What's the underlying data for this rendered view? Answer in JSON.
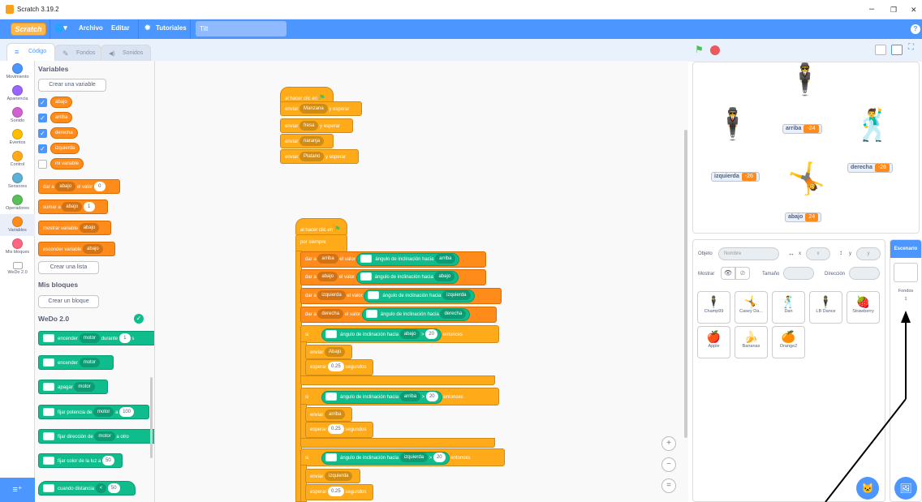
{
  "window": {
    "title": "Scratch 3.19.2",
    "min": "–",
    "max": "❐",
    "close": "✕"
  },
  "menubar": {
    "logo": "Scratch",
    "globe": "🌐▾",
    "archivo": "Archivo",
    "editar": "Editar",
    "tutoriales": "Tutoriales",
    "project_title": "Tilt",
    "help": "?"
  },
  "tabs": [
    {
      "label": "Código",
      "icon": "≡"
    },
    {
      "label": "Fondos",
      "icon": "✎"
    },
    {
      "label": "Sonidos",
      "icon": "◀)"
    }
  ],
  "categories": [
    {
      "label": "Movimiento",
      "color": "#4c97ff"
    },
    {
      "label": "Apariencia",
      "color": "#9966ff"
    },
    {
      "label": "Sonido",
      "color": "#cf63cf"
    },
    {
      "label": "Eventos",
      "color": "#ffbf00"
    },
    {
      "label": "Control",
      "color": "#ffab19"
    },
    {
      "label": "Sensores",
      "color": "#5cb1d6"
    },
    {
      "label": "Operadores",
      "color": "#59c059"
    },
    {
      "label": "Variables",
      "color": "#ff8c1a"
    },
    {
      "label": "Mis bloques",
      "color": "#ff6680"
    },
    {
      "label": "WeDo 2.0",
      "color": "#0fbd8c"
    }
  ],
  "palette": {
    "variables_title": "Variables",
    "create_variable": "Crear una variable",
    "variables": [
      {
        "name": "abajo",
        "checked": true
      },
      {
        "name": "arriba",
        "checked": true
      },
      {
        "name": "derecha",
        "checked": true
      },
      {
        "name": "izquierda",
        "checked": true
      },
      {
        "name": "mi variable",
        "checked": false
      }
    ],
    "set_block": {
      "a": "dar a",
      "var": "abajo",
      "b": "el valor",
      "val": "0"
    },
    "change_block": {
      "a": "sumar a",
      "var": "abajo",
      "val": "1"
    },
    "show_block": {
      "a": "mostrar variable",
      "var": "abajo"
    },
    "hide_block": {
      "a": "esconder variable",
      "var": "abajo"
    },
    "create_list": "Crear una lista",
    "myblocks_title": "Mis bloques",
    "create_block": "Crear un bloque",
    "wedo_title": "WeDo 2.0",
    "wedo_blocks": [
      {
        "a": "encender",
        "dd": "motor",
        "b": "durante",
        "val": "1",
        "c": "s"
      },
      {
        "a": "encender",
        "dd": "motor",
        "b": "",
        "val": "",
        "c": ""
      },
      {
        "a": "apagar",
        "dd": "motor",
        "b": "",
        "val": "",
        "c": ""
      },
      {
        "a": "fijar potencia de",
        "dd": "motor",
        "b": "a",
        "val": "100",
        "c": ""
      },
      {
        "a": "fijar dirección de",
        "dd": "motor",
        "b": "a",
        "val": "",
        "c": "otro"
      },
      {
        "a": "fijar color de la luz a",
        "dd": "",
        "b": "",
        "val": "50",
        "c": ""
      },
      {
        "a": "cuando distancia",
        "dd": "<",
        "b": "",
        "val": "50",
        "c": ""
      }
    ]
  },
  "script1": {
    "hat": "al hacer clic en",
    "rows": [
      {
        "a": "enviar",
        "dd": "Manzana",
        "b": "y esperar"
      },
      {
        "a": "enviar",
        "dd": "fresa",
        "b": "y esperar"
      },
      {
        "a": "enviar",
        "dd": "naranja",
        "b": ""
      },
      {
        "a": "enviar",
        "dd": "Platano",
        "b": "y esperar"
      }
    ]
  },
  "script2": {
    "hat": "al hacer clic en",
    "forever": "por siempre",
    "sets": [
      {
        "a": "dar a",
        "var": "arriba",
        "b": "el valor",
        "sensor": "ángulo de inclinación hacia",
        "dir": "arriba"
      },
      {
        "a": "dar a",
        "var": "abajo",
        "b": "el valor",
        "sensor": "ángulo de inclinación hacia",
        "dir": "abajo"
      },
      {
        "a": "dar a",
        "var": "izquierda",
        "b": "el valor",
        "sensor": "ángulo de inclinación hacia",
        "dir": "izquierda"
      },
      {
        "a": "dar a",
        "var": "derecha",
        "b": "el valor",
        "sensor": "ángulo de inclinación hacia",
        "dir": "derecha"
      }
    ],
    "ifs": [
      {
        "si": "si",
        "sensor": "ángulo de inclinación hacia",
        "dir": "abajo",
        "op": ">",
        "val": "20",
        "then": "entonces",
        "msg_a": "enviar",
        "msg": "Abajo",
        "wait_a": "esperar",
        "wait": "0.25",
        "wait_b": "segundos"
      },
      {
        "si": "si",
        "sensor": "ángulo de inclinación hacia",
        "dir": "arriba",
        "op": ">",
        "val": "20",
        "then": "entonces",
        "msg_a": "enviar",
        "msg": "arriba",
        "wait_a": "esperar",
        "wait": "0.25",
        "wait_b": "segundos"
      },
      {
        "si": "si",
        "sensor": "ángulo de inclinación hacia",
        "dir": "izquierda",
        "op": ">",
        "val": "20",
        "then": "entonces",
        "msg_a": "enviar",
        "msg": "izquierda",
        "wait_a": "esperar",
        "wait": "0.25",
        "wait_b": "segundos"
      }
    ]
  },
  "zoom": {
    "in": "+",
    "out": "−",
    "reset": "="
  },
  "stage": {
    "monitors": [
      {
        "label": "arriba",
        "value": "-24"
      },
      {
        "label": "izquierda",
        "value": "-26"
      },
      {
        "label": "derecha",
        "value": "-26"
      },
      {
        "label": "abajo",
        "value": "24"
      }
    ]
  },
  "sprite_info": {
    "object_label": "Objeto",
    "name_placeholder": "Nombre",
    "x_sym": "↔",
    "x_label": "x",
    "x_val": "x",
    "y_sym": "↕",
    "y_label": "y",
    "y_val": "y",
    "show_label": "Mostrar",
    "size_label": "Tamaño",
    "direction_label": "Dirección"
  },
  "sprites": [
    {
      "name": "Champ99",
      "glyph": "🕴"
    },
    {
      "name": "Casey Da...",
      "glyph": "🤸"
    },
    {
      "name": "Dan",
      "glyph": "🕺"
    },
    {
      "name": "LB Dance",
      "glyph": "🕴"
    },
    {
      "name": "Strawberry",
      "glyph": "🍓"
    },
    {
      "name": "Apple",
      "glyph": "🍎"
    },
    {
      "name": "Bananas",
      "glyph": "🍌"
    },
    {
      "name": "Orange2",
      "glyph": "🍊"
    }
  ],
  "stage_panel": {
    "title": "Escenario",
    "backdrops_label": "Fondos",
    "backdrops_count": "1"
  }
}
